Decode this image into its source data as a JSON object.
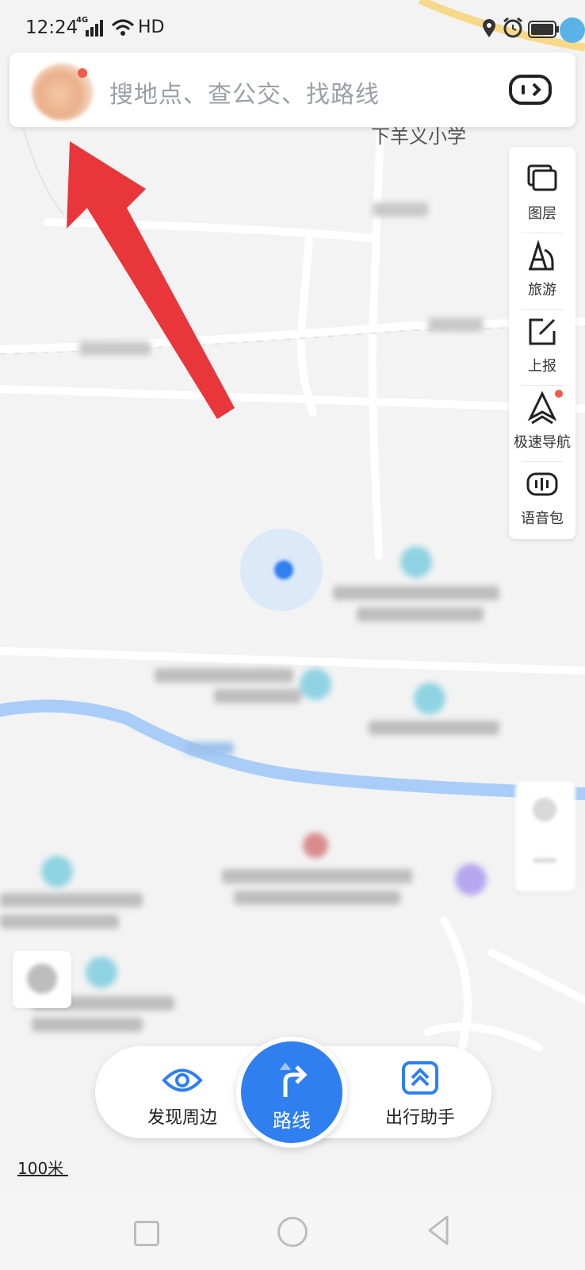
{
  "status_bar": {
    "time": "12:24",
    "network": "4G",
    "wifi_label": "HD"
  },
  "search": {
    "placeholder": "搜地点、查公交、找路线"
  },
  "map": {
    "nearby_label": "下羊义小学",
    "scale_label": "100米"
  },
  "right_toolbar": {
    "items": [
      {
        "label": "图层",
        "icon": "layers-icon"
      },
      {
        "label": "旅游",
        "icon": "tourism-icon"
      },
      {
        "label": "上报",
        "icon": "report-icon"
      },
      {
        "label": "极速导航",
        "icon": "fast-navigation-icon"
      },
      {
        "label": "语音包",
        "icon": "voice-pack-icon"
      }
    ]
  },
  "bottom_bar": {
    "discover_label": "发现周边",
    "route_label": "路线",
    "assistant_label": "出行助手"
  },
  "colors": {
    "accent": "#2f7ff0",
    "annotation_arrow": "#e8363a",
    "notification_dot": "#f25a4a"
  }
}
